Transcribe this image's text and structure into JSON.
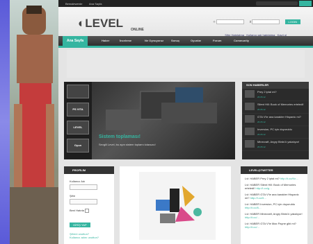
{
  "colors": {
    "accent": "#35b5a0",
    "frame": "#6a6ae0"
  },
  "topbar": {
    "links": [
      "Bemalewerde",
      "Ana Sayfa"
    ],
    "search_label": "Arama..."
  },
  "header": {
    "logo": "LEVEL",
    "logo_sub": "ONLINE",
    "login_button": "LOGIN",
    "login_links": [
      "Şifre Hatırlatma",
      "Kullanıcı adı hatırlatma",
      "Kayıt ol"
    ]
  },
  "nav": {
    "items": [
      "Ana Sayfa",
      "Haber",
      "İnceleme",
      "Ne Oynuyoruz",
      "Sonuç",
      "Oyunlar",
      "Forum",
      "Community"
    ]
  },
  "slider": {
    "thumbs": [
      "",
      "PS VITA",
      "LEVEL",
      "Oyun"
    ],
    "title": "Sistem toplaması!",
    "subtitle": "Sevgili Level, bu ayın sistem toplamı kılavuzu!"
  },
  "news": {
    "heading": "SON HABERLER",
    "items": [
      {
        "title": "Prey 2 iptal mi?",
        "date": "26.05.12"
      },
      {
        "title": "Silent Hill: Book of Memories erteledi!",
        "date": "26.05.12"
      },
      {
        "title": "GTA V'te ana karakter Hispanic mi?",
        "date": "26.05.12"
      },
      {
        "title": "Inversion, PC için duyuruldu",
        "date": "26.05.12"
      },
      {
        "title": "Minecraft, Angry Birds'ü yakalıyor!",
        "date": "26.05.12"
      }
    ]
  },
  "profile": {
    "heading": "PROFİLİM",
    "username_label": "Kullanıcı Adı",
    "password_label": "Şifre",
    "remember_label": "Beni Hatırla",
    "submit_label": "GİRİŞ YAP",
    "links": [
      "Şifreni unuttun?",
      "Kullanıcı adını unuttun?"
    ]
  },
  "twitter": {
    "heading": "LEVEL@TWITTER",
    "tweets": [
      {
        "text": "Lvl: HABER Prey 2 iptal mi?",
        "link": "http://t.co/Kn…"
      },
      {
        "text": "Lvl: HABER Silent Hill: Book of Memories erteledi!",
        "link": "http://t.co/g…"
      },
      {
        "text": "Lvl: HABER GTA V'te ana karakter Hispanic mi?",
        "link": "http://t.co/5…"
      },
      {
        "text": "Lvl: HABER Inversion, PC için duyuruldu",
        "link": "http://t.co/6…"
      },
      {
        "text": "Lvl: HABER Minecraft, Angry Birds'ü yakalıyor!",
        "link": "http://t.co/…"
      },
      {
        "text": "Lvl: HABER GTA V'te Max Payne gibi mi?",
        "link": "http://t.co/…"
      }
    ]
  }
}
